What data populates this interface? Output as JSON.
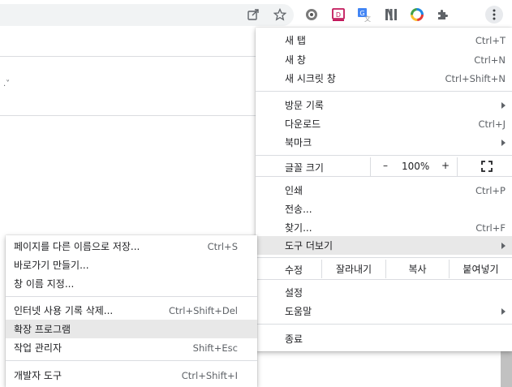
{
  "toolbar": {
    "icons": [
      "share-icon",
      "star-icon",
      "settings-ext-icon",
      "media-ext-icon",
      "translate-ext-icon",
      "notion-ext-icon",
      "color-ext-icon",
      "puzzle-icon",
      "more-icon"
    ]
  },
  "main_menu": {
    "new_tab": {
      "label": "새 탭",
      "shortcut": "Ctrl+T"
    },
    "new_window": {
      "label": "새 창",
      "shortcut": "Ctrl+N"
    },
    "new_incognito": {
      "label": "새 시크릿 창",
      "shortcut": "Ctrl+Shift+N"
    },
    "history": {
      "label": "방문 기록"
    },
    "downloads": {
      "label": "다운로드",
      "shortcut": "Ctrl+J"
    },
    "bookmarks": {
      "label": "북마크"
    },
    "zoom": {
      "label": "글꼴 크기",
      "minus": "–",
      "value": "100%",
      "plus": "+"
    },
    "print": {
      "label": "인쇄",
      "shortcut": "Ctrl+P"
    },
    "cast": {
      "label": "전송..."
    },
    "find": {
      "label": "찾기...",
      "shortcut": "Ctrl+F"
    },
    "more_tools": {
      "label": "도구 더보기"
    },
    "edit": {
      "label": "수정",
      "cut": "잘라내기",
      "copy": "복사",
      "paste": "붙여넣기"
    },
    "settings": {
      "label": "설정"
    },
    "help": {
      "label": "도움말"
    },
    "exit": {
      "label": "종료"
    }
  },
  "sub_menu": {
    "save_page": {
      "label": "페이지를 다른 이름으로 저장...",
      "shortcut": "Ctrl+S"
    },
    "create_shortcut": {
      "label": "바로가기 만들기..."
    },
    "name_window": {
      "label": "창 이름 지정..."
    },
    "clear_data": {
      "label": "인터넷 사용 기록 삭제...",
      "shortcut": "Ctrl+Shift+Del"
    },
    "extensions": {
      "label": "확장 프로그램"
    },
    "task_manager": {
      "label": "작업 관리자",
      "shortcut": "Shift+Esc"
    },
    "dev_tools": {
      "label": "개발자 도구",
      "shortcut": "Ctrl+Shift+I"
    }
  },
  "colors": {
    "highlight": "#e8e8e8",
    "separator": "#dadce0",
    "omnibox": "#f1f3f4"
  }
}
